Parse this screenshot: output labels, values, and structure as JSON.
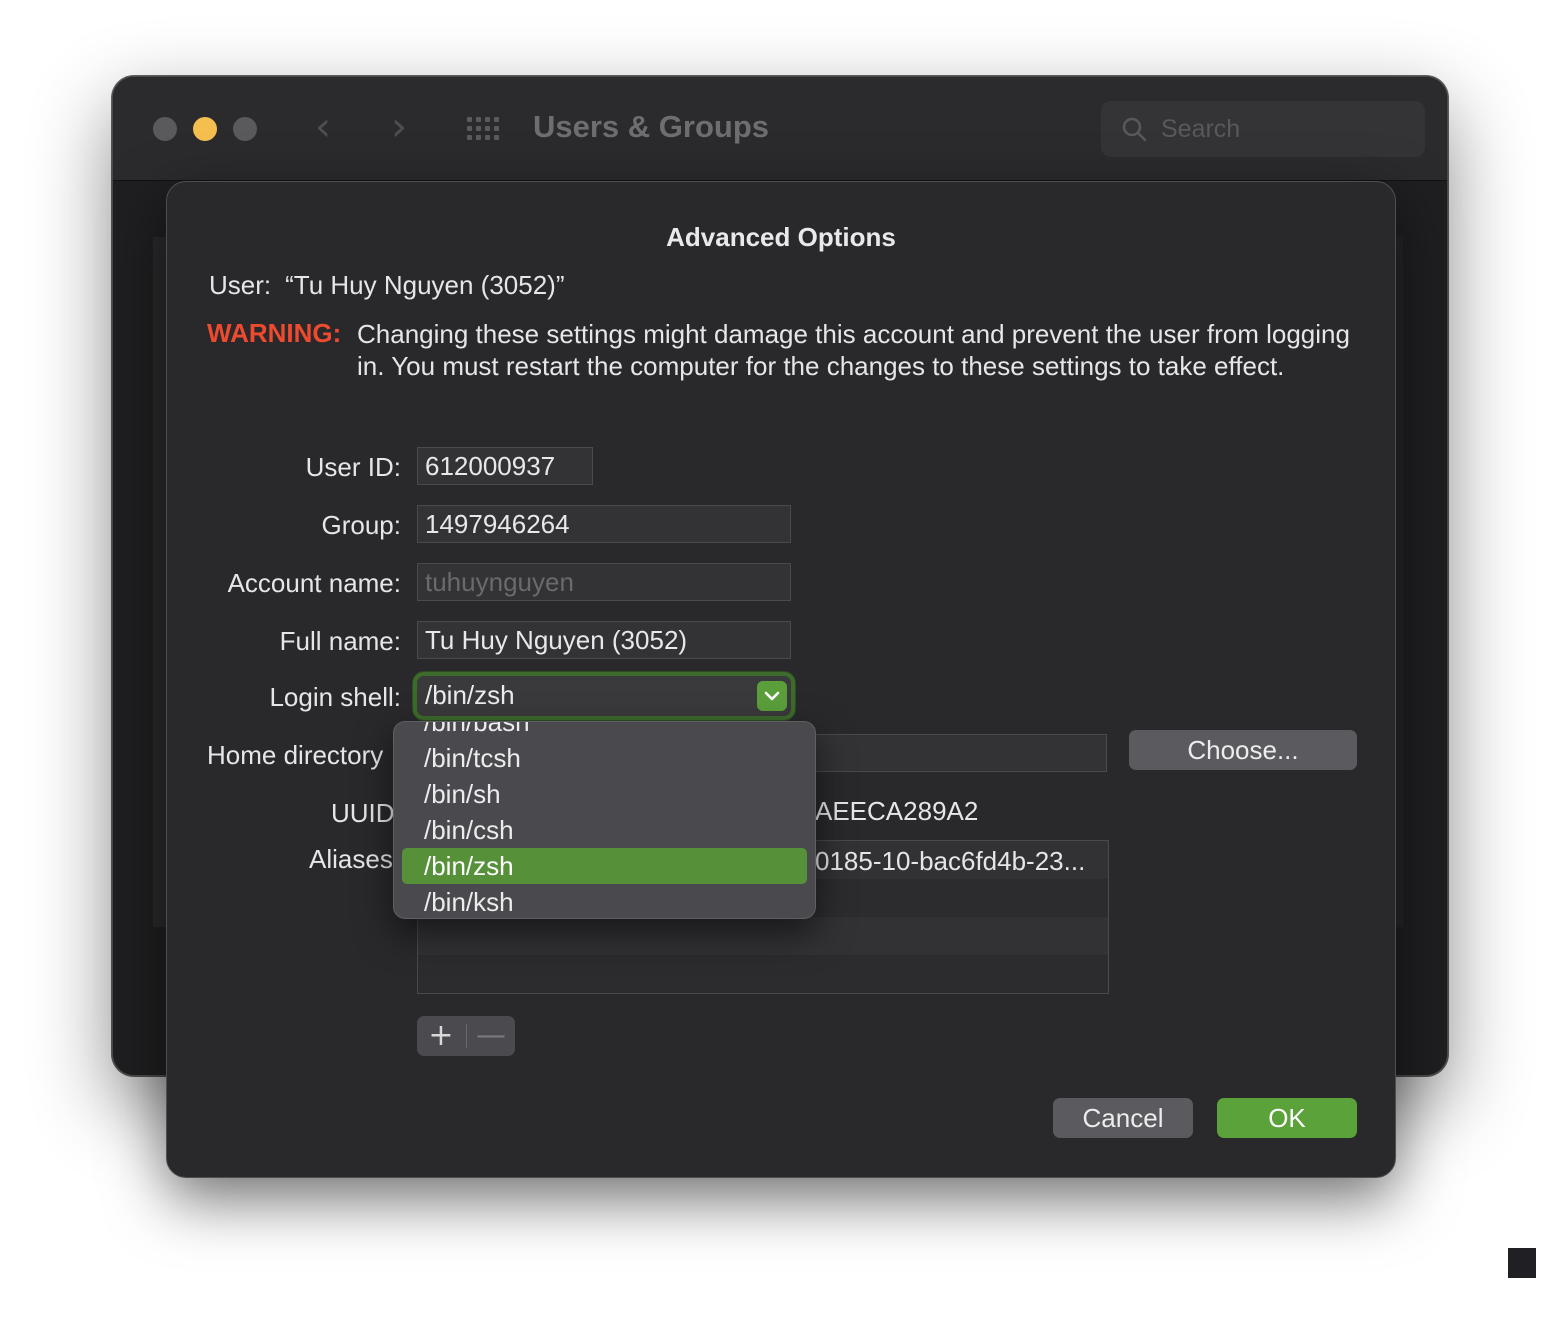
{
  "window": {
    "title": "Users & Groups",
    "search_placeholder": "Search"
  },
  "sheet": {
    "title": "Advanced Options",
    "user_label": "User:",
    "user_value": "“Tu Huy Nguyen (3052)”",
    "warning_label": "WARNING:",
    "warning_text": "Changing these settings might damage this account and prevent the user from logging in. You must restart the computer for the changes to these settings to take effect.",
    "fields": {
      "user_id": {
        "label": "User ID:",
        "value": "612000937"
      },
      "group": {
        "label": "Group:",
        "value": "1497946264"
      },
      "account_name": {
        "label": "Account name:",
        "value": "tuhuynguyen"
      },
      "full_name": {
        "label": "Full name:",
        "value": "Tu Huy Nguyen (3052)"
      },
      "login_shell": {
        "label": "Login shell:",
        "value": "/bin/zsh"
      },
      "home_directory": {
        "label": "Home directory",
        "button": "Choose..."
      },
      "uuid": {
        "label": "UUID",
        "value": "AEECA289A2"
      },
      "aliases": {
        "label": "Aliases",
        "value": "0185-10-bac6fd4b-23..."
      }
    },
    "add_label": "+",
    "remove_label": "—",
    "cancel_label": "Cancel",
    "ok_label": "OK"
  },
  "shell_menu": {
    "items": [
      "/bin/bash",
      "/bin/tcsh",
      "/bin/sh",
      "/bin/csh",
      "/bin/zsh",
      "/bin/ksh"
    ],
    "selected": "/bin/zsh"
  },
  "colors": {
    "accent_green": "#5ba23a",
    "warning_red": "#ee4a2f",
    "minimize_yellow": "#f4bf4f"
  }
}
